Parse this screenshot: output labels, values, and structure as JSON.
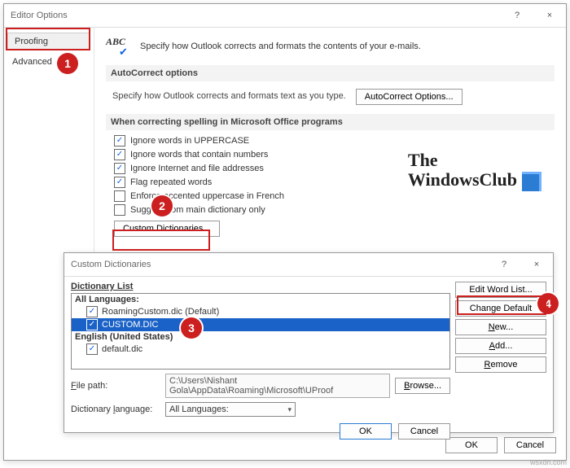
{
  "mainWindow": {
    "title": "Editor Options",
    "help": "?",
    "close": "×"
  },
  "sidebar": {
    "items": [
      "Proofing",
      "Advanced"
    ]
  },
  "intro": "Specify how Outlook corrects and formats the contents of your e-mails.",
  "sections": {
    "autoCorrectHeader": "AutoCorrect options",
    "autoCorrectText": "Specify how Outlook corrects and formats text as you type.",
    "autoCorrectBtn": "AutoCorrect Options...",
    "spellHeader": "When correcting spelling in Microsoft Office programs"
  },
  "checks": [
    {
      "label": "Ignore words in UPPERCASE",
      "on": true
    },
    {
      "label": "Ignore words that contain numbers",
      "on": true
    },
    {
      "label": "Ignore Internet and file addresses",
      "on": true
    },
    {
      "label": "Flag repeated words",
      "on": true
    },
    {
      "label": "Enforce accented uppercase in French",
      "on": false
    },
    {
      "label": "Suggest from main dictionary only",
      "on": false
    }
  ],
  "customDictBtn": "Custom Dictionaries...",
  "logo": {
    "line1": "The",
    "line2": "WindowsClub"
  },
  "mainFooter": {
    "ok": "OK",
    "cancel": "Cancel"
  },
  "modal": {
    "title": "Custom Dictionaries",
    "help": "?",
    "close": "×",
    "listLabel": "Dictionary List",
    "group1": "All Languages:",
    "item1": "RoamingCustom.dic (Default)",
    "item2": "CUSTOM.DIC",
    "group2": "English (United States)",
    "item3": "default.dic",
    "btns": {
      "edit": "Edit Word List...",
      "change": "Change Default",
      "new": "New...",
      "add": "Add...",
      "remove": "Remove",
      "browse": "Browse..."
    },
    "pathLabel": "File path:",
    "pathValue": "C:\\Users\\Nishant Gola\\AppData\\Roaming\\Microsoft\\UProof",
    "langLabel": "Dictionary language:",
    "langValue": "All Languages:",
    "ok": "OK",
    "cancel": "Cancel"
  },
  "markers": {
    "m1": "1",
    "m2": "2",
    "m3": "3",
    "m4": "4"
  },
  "watermark": "wsxdn.com"
}
